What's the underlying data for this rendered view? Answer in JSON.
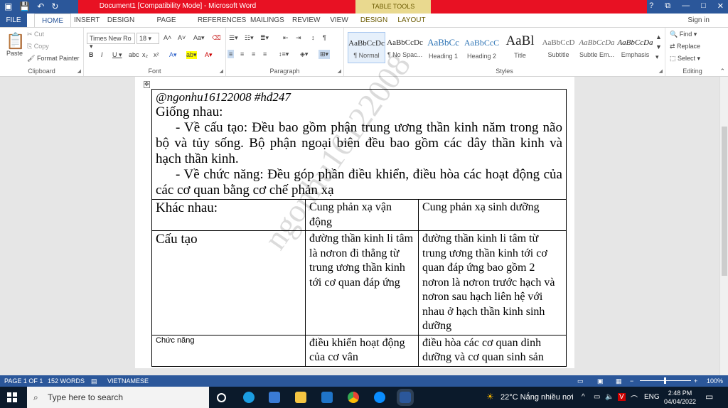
{
  "titlebar": {
    "title": "Document1 [Compatibility Mode] - Microsoft Word",
    "table_tools": "TABLE TOOLS",
    "help": "?",
    "restore": "⧉",
    "minimize": "—",
    "maximize": "□",
    "close": "✕"
  },
  "tabs": [
    "FILE",
    "HOME",
    "INSERT",
    "DESIGN",
    "PAGE LAYOUT",
    "REFERENCES",
    "MAILINGS",
    "REVIEW",
    "VIEW",
    "DESIGN",
    "LAYOUT"
  ],
  "signin": "Sign in",
  "clipboard": {
    "paste": "Paste",
    "cut": "Cut",
    "copy": "Copy",
    "format_painter": "Format Painter",
    "label": "Clipboard"
  },
  "font": {
    "name": "Times New Ro",
    "size": "18",
    "label": "Font"
  },
  "paragraph": {
    "label": "Paragraph"
  },
  "styles": {
    "label": "Styles",
    "items": [
      {
        "preview": "AaBbCcDc",
        "name": "¶ Normal"
      },
      {
        "preview": "AaBbCcDc",
        "name": "¶ No Spac..."
      },
      {
        "preview": "AaBbCc",
        "name": "Heading 1"
      },
      {
        "preview": "AaBbCcC",
        "name": "Heading 2"
      },
      {
        "preview": "AaBl",
        "name": "Title"
      },
      {
        "preview": "AaBbCcD",
        "name": "Subtitle"
      },
      {
        "preview": "AaBbCcDa",
        "name": "Subtle Em..."
      },
      {
        "preview": "AaBbCcDa",
        "name": "Emphasis"
      }
    ]
  },
  "editing": {
    "find": "Find",
    "replace": "Replace",
    "select": "Select",
    "label": "Editing"
  },
  "doc": {
    "handle": "@ngonhu16122008 #hđ247",
    "giong": "Giống nhau:",
    "p1": "- Về cấu tạo: Đều bao gồm phận trung ương thần kinh năm trong não bộ và tủy sống. Bộ phận ngoại biên đều bao gồm các dây thần kinh và hạch thần kinh.",
    "p2": "- Về chức năng: Đều góp phần điều khiển, điều hòa các hoạt động của các cơ quan bằng cơ chế phản xạ",
    "khac": "Khác nhau:",
    "col1": "Cung phản xạ vận động",
    "col2": "Cung phản xạ sinh dưỡng",
    "cautao": "Cấu tạo",
    "ct1": "đường thần kinh li tâm là nơron đi thẳng từ trung ương thần kinh tới cơ quan đáp ứng",
    "ct2": "đường thần kinh li tâm từ trung ương thần kinh tới cơ quan đáp ứng bao gồm 2 nơron là nơron trước hạch và nơron sau hạch liên hệ với nhau ở hạch thần kinh sinh dưỡng",
    "chucnang": "Chức năng",
    "cn1": "điều khiển hoạt động của cơ vân",
    "cn2": "điều hòa các cơ quan dinh dưỡng và cơ quan sinh sản",
    "watermark": "ngonhu16122008"
  },
  "status": {
    "page": "PAGE 1 OF 1",
    "words": "152 WORDS",
    "lang": "VIETNAMESE",
    "zoom": "100%"
  },
  "taskbar": {
    "search": "Type here to search",
    "weather": "22°C  Nắng nhiều nơi",
    "ime": "ENG",
    "time": "2:48 PM",
    "date": "04/04/2022"
  }
}
